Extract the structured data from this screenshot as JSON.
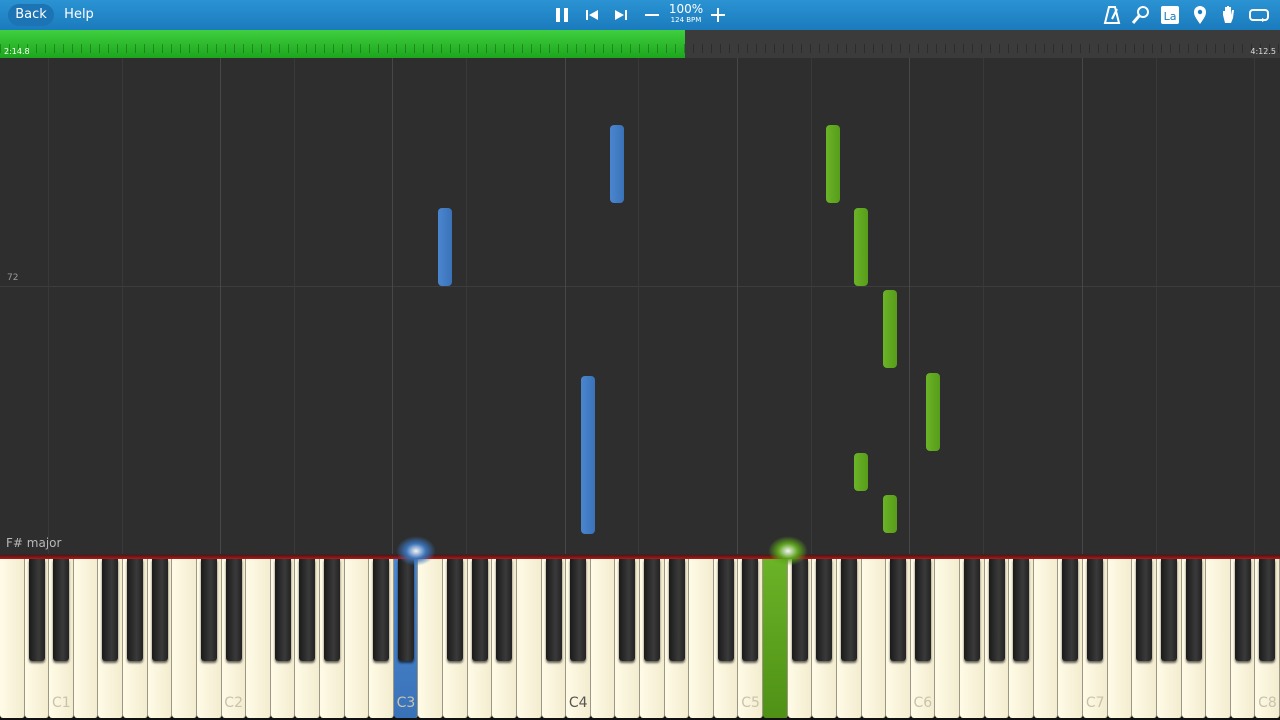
{
  "toolbar": {
    "back_label": "Back",
    "help_label": "Help",
    "speed_percent": "100%",
    "bpm": "124 BPM",
    "icons": [
      "pause-icon",
      "previous-icon",
      "next-icon",
      "minus-icon",
      "plus-icon",
      "metronome-icon",
      "magnifier-icon",
      "label-icon",
      "location-pin-icon",
      "hand-icon",
      "loop-icon"
    ],
    "label_button_text": "La"
  },
  "progress": {
    "current_time": "2:14.8",
    "total_time": "4:12.5",
    "fraction": 0.535,
    "color": "#2bbd2b"
  },
  "roll": {
    "measure_number": "72",
    "key_signature": "F# major"
  },
  "keyboard": {
    "octave_labels": [
      "C1",
      "C2",
      "C3",
      "C4",
      "C5",
      "C6",
      "C7",
      "C8"
    ],
    "active_label": "C4",
    "left_hand_color": "#3a72b8",
    "right_hand_color": "#5ca21d"
  }
}
